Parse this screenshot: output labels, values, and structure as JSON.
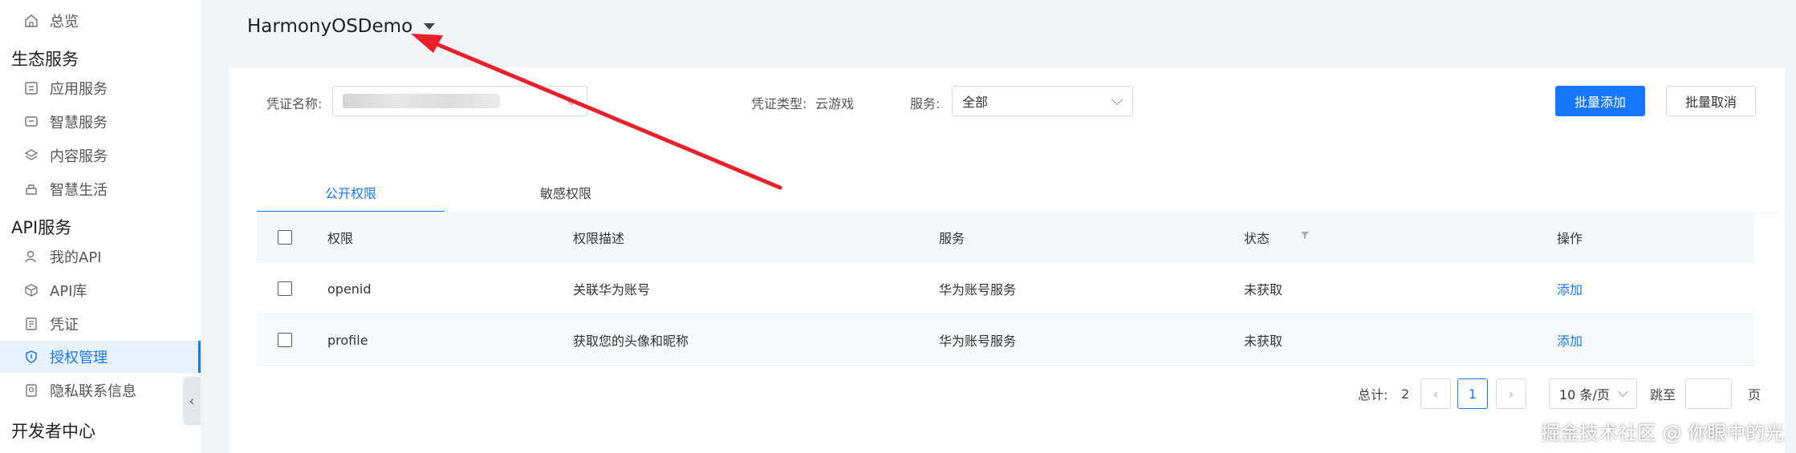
{
  "sidebar": {
    "overview": "总览",
    "groups": {
      "eco": "生态服务",
      "api": "API服务",
      "dev": "开发者中心"
    },
    "items": [
      {
        "label": "应用服务",
        "icon": "app-service-icon"
      },
      {
        "label": "智慧服务",
        "icon": "smart-service-icon"
      },
      {
        "label": "内容服务",
        "icon": "content-service-icon"
      },
      {
        "label": "智慧生活",
        "icon": "smart-life-icon"
      },
      {
        "label": "我的API",
        "icon": "user-icon"
      },
      {
        "label": "API库",
        "icon": "cube-icon"
      },
      {
        "label": "凭证",
        "icon": "credential-icon"
      },
      {
        "label": "授权管理",
        "icon": "shield-icon",
        "active": true
      },
      {
        "label": "隐私联系信息",
        "icon": "privacy-icon"
      }
    ],
    "collapse_glyph": "‹"
  },
  "header": {
    "project_name": "HarmonyOSDemo"
  },
  "filters": {
    "credential_name_label": "凭证名称:",
    "credential_type_label": "凭证类型:",
    "credential_type_value": "云游戏",
    "service_label": "服务:",
    "service_value": "全部"
  },
  "actions": {
    "batch_add": "批量添加",
    "batch_cancel": "批量取消"
  },
  "tabs": [
    {
      "label": "公开权限",
      "active": true
    },
    {
      "label": "敏感权限",
      "active": false
    }
  ],
  "table": {
    "columns": [
      "权限",
      "权限描述",
      "服务",
      "状态",
      "操作"
    ],
    "rows": [
      {
        "permission": "openid",
        "description": "关联华为账号",
        "service": "华为账号服务",
        "status": "未获取",
        "action": "添加"
      },
      {
        "permission": "profile",
        "description": "获取您的头像和昵称",
        "service": "华为账号服务",
        "status": "未获取",
        "action": "添加"
      }
    ]
  },
  "pagination": {
    "total_label": "总计:",
    "total": "2",
    "prev": "‹",
    "current_page": "1",
    "next": "›",
    "page_size": "10 条/页",
    "jump_label": "跳至",
    "page_suffix": "页"
  },
  "watermark": "掘金技术社区 @ 你眼中的光",
  "colors": {
    "accent": "#1677ff",
    "annotation_arrow": "#e8202a"
  }
}
